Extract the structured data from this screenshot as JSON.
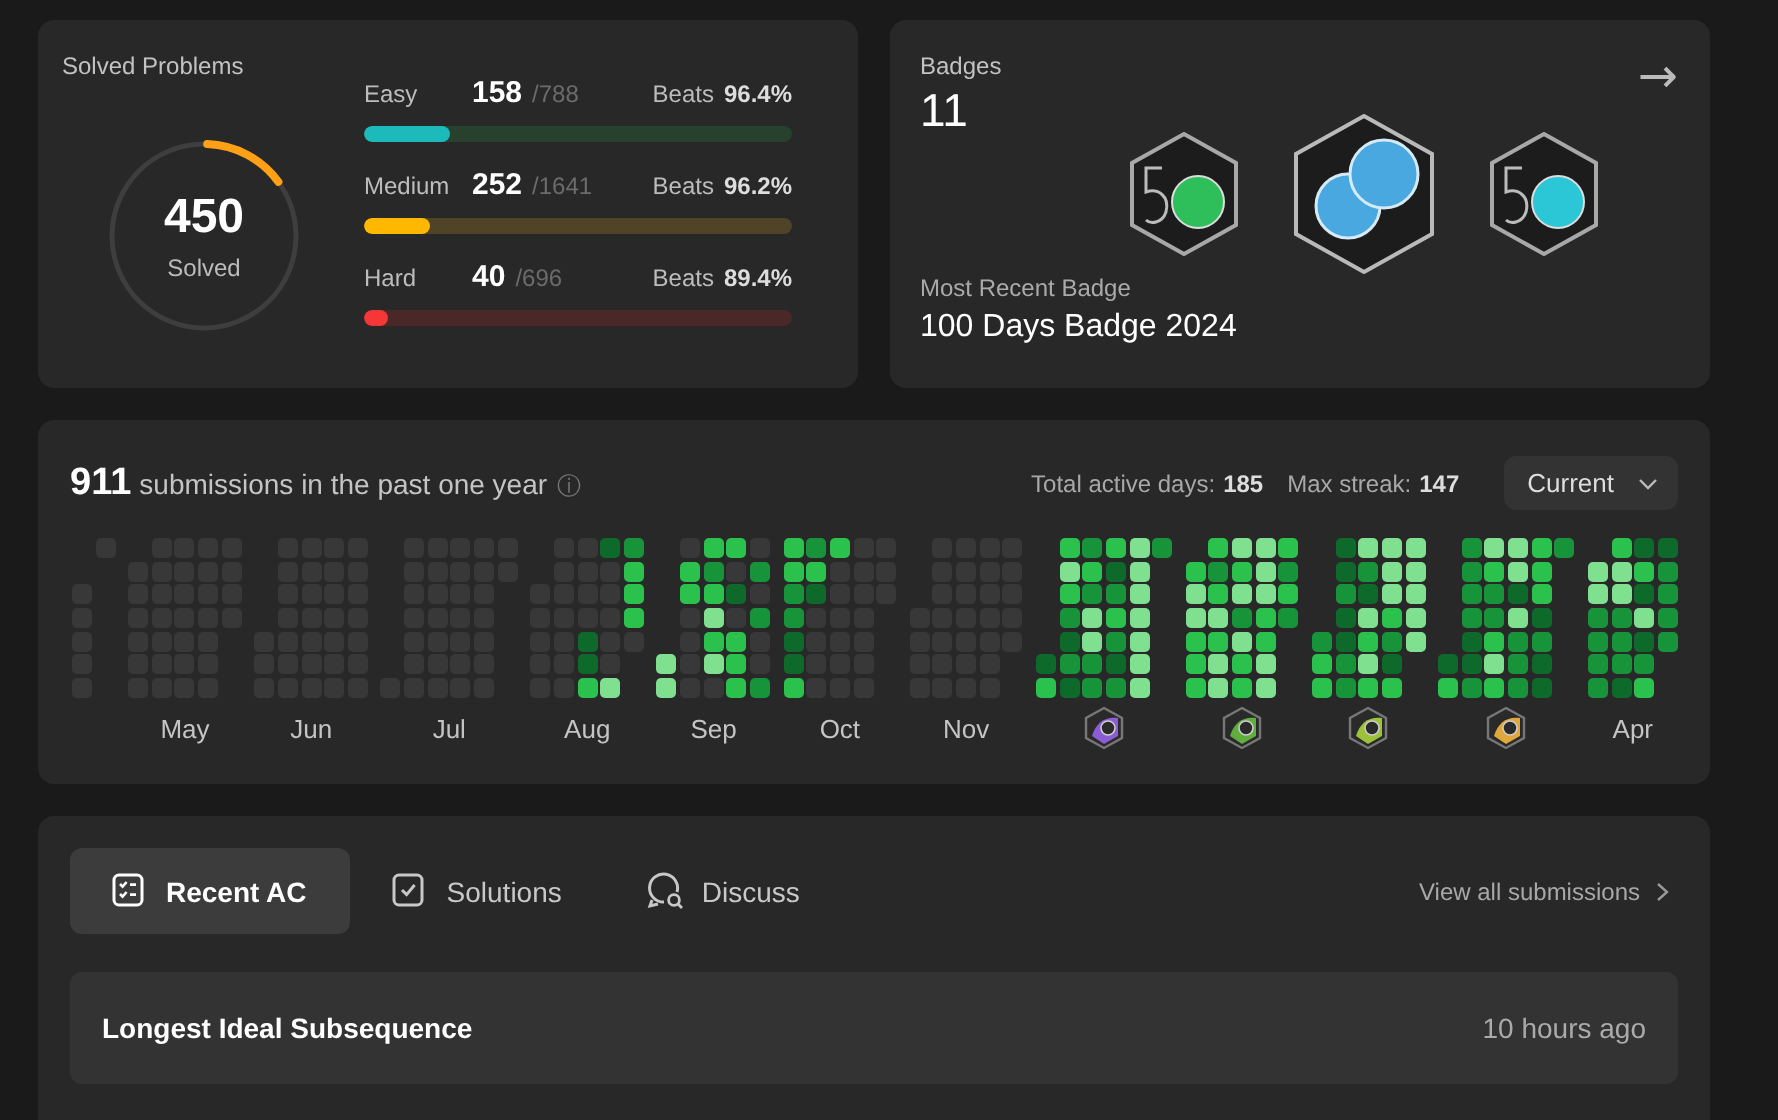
{
  "solved": {
    "title": "Solved Problems",
    "total": "450",
    "caption": "Solved",
    "level": 0.144,
    "difficulties": [
      {
        "kind": "easy",
        "name": "Easy",
        "count": "158",
        "of": "/788",
        "beats_label": "Beats",
        "beats": "96.4%",
        "level": 0.2
      },
      {
        "kind": "medium",
        "name": "Medium",
        "count": "252",
        "of": "/1641",
        "beats_label": "Beats",
        "beats": "96.2%",
        "level": 0.154
      },
      {
        "kind": "hard",
        "name": "Hard",
        "count": "40",
        "of": "/696",
        "beats_label": "Beats",
        "beats": "89.4%",
        "level": 0.057
      }
    ]
  },
  "badges": {
    "title": "Badges",
    "count": "11",
    "arrow": "→",
    "items": [
      {
        "kind": "fifty",
        "color": "#2fbf5a"
      },
      {
        "kind": "hundred",
        "color": "#4aa8e0"
      },
      {
        "kind": "fifty",
        "color": "#2cc7d6"
      }
    ],
    "recent_label": "Most Recent Badge",
    "recent": "100 Days Badge 2024"
  },
  "heatmap": {
    "count": "911",
    "text": "submissions in the past one year",
    "info": "ⓘ",
    "active_label": "Total active days:",
    "active": "185",
    "streak_label": "Max streak:",
    "streak": "147",
    "select": "Current",
    "months": [
      {
        "kind": "none",
        "weeks": [
          {
            "kind": "head",
            "days": [
              {
                "color": "#383838"
              },
              {
                "color": "#383838"
              },
              {
                "color": "#383838"
              },
              {
                "color": "#383838"
              },
              {
                "color": "#383838"
              }
            ]
          },
          {
            "kind": "tail",
            "days": [
              {
                "color": "#383838"
              }
            ]
          }
        ]
      },
      {
        "kind": "month",
        "label": "May",
        "weeks": [
          {
            "kind": "head",
            "days": [
              {
                "color": "#383838"
              },
              {
                "color": "#383838"
              },
              {
                "color": "#383838"
              },
              {
                "color": "#383838"
              },
              {
                "color": "#383838"
              },
              {
                "color": "#383838"
              }
            ]
          },
          {
            "kind": "full",
            "days": [
              {
                "color": "#383838"
              },
              {
                "color": "#383838"
              },
              {
                "color": "#383838"
              },
              {
                "color": "#383838"
              },
              {
                "color": "#383838"
              },
              {
                "color": "#383838"
              },
              {
                "color": "#383838"
              }
            ]
          },
          {
            "kind": "full",
            "days": [
              {
                "color": "#383838"
              },
              {
                "color": "#383838"
              },
              {
                "color": "#383838"
              },
              {
                "color": "#383838"
              },
              {
                "color": "#383838"
              },
              {
                "color": "#383838"
              },
              {
                "color": "#383838"
              }
            ]
          },
          {
            "kind": "full",
            "days": [
              {
                "color": "#383838"
              },
              {
                "color": "#383838"
              },
              {
                "color": "#383838"
              },
              {
                "color": "#383838"
              },
              {
                "color": "#383838"
              },
              {
                "color": "#383838"
              },
              {
                "color": "#383838"
              }
            ]
          },
          {
            "kind": "tail",
            "days": [
              {
                "color": "#383838"
              },
              {
                "color": "#383838"
              },
              {
                "color": "#383838"
              },
              {
                "color": "#383838"
              }
            ]
          }
        ]
      },
      {
        "kind": "month",
        "label": "Jun",
        "weeks": [
          {
            "kind": "head",
            "days": [
              {
                "color": "#383838"
              },
              {
                "color": "#383838"
              },
              {
                "color": "#383838"
              }
            ]
          },
          {
            "kind": "full",
            "days": [
              {
                "color": "#383838"
              },
              {
                "color": "#383838"
              },
              {
                "color": "#383838"
              },
              {
                "color": "#383838"
              },
              {
                "color": "#383838"
              },
              {
                "color": "#383838"
              },
              {
                "color": "#383838"
              }
            ]
          },
          {
            "kind": "full",
            "days": [
              {
                "color": "#383838"
              },
              {
                "color": "#383838"
              },
              {
                "color": "#383838"
              },
              {
                "color": "#383838"
              },
              {
                "color": "#383838"
              },
              {
                "color": "#383838"
              },
              {
                "color": "#383838"
              }
            ]
          },
          {
            "kind": "full",
            "days": [
              {
                "color": "#383838"
              },
              {
                "color": "#383838"
              },
              {
                "color": "#383838"
              },
              {
                "color": "#383838"
              },
              {
                "color": "#383838"
              },
              {
                "color": "#383838"
              },
              {
                "color": "#383838"
              }
            ]
          },
          {
            "kind": "full",
            "days": [
              {
                "color": "#383838"
              },
              {
                "color": "#383838"
              },
              {
                "color": "#383838"
              },
              {
                "color": "#383838"
              },
              {
                "color": "#383838"
              },
              {
                "color": "#383838"
              },
              {
                "color": "#383838"
              }
            ]
          }
        ]
      },
      {
        "kind": "month",
        "label": "Jul",
        "weeks": [
          {
            "kind": "head",
            "days": [
              {
                "color": "#383838"
              }
            ]
          },
          {
            "kind": "full",
            "days": [
              {
                "color": "#383838"
              },
              {
                "color": "#383838"
              },
              {
                "color": "#383838"
              },
              {
                "color": "#383838"
              },
              {
                "color": "#383838"
              },
              {
                "color": "#383838"
              },
              {
                "color": "#383838"
              }
            ]
          },
          {
            "kind": "full",
            "days": [
              {
                "color": "#383838"
              },
              {
                "color": "#383838"
              },
              {
                "color": "#383838"
              },
              {
                "color": "#383838"
              },
              {
                "color": "#383838"
              },
              {
                "color": "#383838"
              },
              {
                "color": "#383838"
              }
            ]
          },
          {
            "kind": "full",
            "days": [
              {
                "color": "#383838"
              },
              {
                "color": "#383838"
              },
              {
                "color": "#383838"
              },
              {
                "color": "#383838"
              },
              {
                "color": "#383838"
              },
              {
                "color": "#383838"
              },
              {
                "color": "#383838"
              }
            ]
          },
          {
            "kind": "full",
            "days": [
              {
                "color": "#383838"
              },
              {
                "color": "#383838"
              },
              {
                "color": "#383838"
              },
              {
                "color": "#383838"
              },
              {
                "color": "#383838"
              },
              {
                "color": "#383838"
              },
              {
                "color": "#383838"
              }
            ]
          },
          {
            "kind": "tail",
            "days": [
              {
                "color": "#383838"
              },
              {
                "color": "#383838"
              }
            ]
          }
        ]
      },
      {
        "kind": "month",
        "label": "Aug",
        "weeks": [
          {
            "kind": "head",
            "days": [
              {
                "color": "#383838"
              },
              {
                "color": "#383838"
              },
              {
                "color": "#383838"
              },
              {
                "color": "#383838"
              },
              {
                "color": "#383838"
              }
            ]
          },
          {
            "kind": "full",
            "days": [
              {
                "color": "#383838"
              },
              {
                "color": "#383838"
              },
              {
                "color": "#383838"
              },
              {
                "color": "#383838"
              },
              {
                "color": "#383838"
              },
              {
                "color": "#383838"
              },
              {
                "color": "#383838"
              }
            ]
          },
          {
            "kind": "full",
            "days": [
              {
                "color": "#383838"
              },
              {
                "color": "#383838"
              },
              {
                "color": "#383838"
              },
              {
                "color": "#383838"
              },
              {
                "color": "#0e6a2a"
              },
              {
                "color": "#0e6a2a"
              },
              {
                "color": "#2ac24d"
              }
            ]
          },
          {
            "kind": "full",
            "days": [
              {
                "color": "#0e6a2a"
              },
              {
                "color": "#383838"
              },
              {
                "color": "#383838"
              },
              {
                "color": "#383838"
              },
              {
                "color": "#383838"
              },
              {
                "color": "#383838"
              },
              {
                "color": "#7fe08f"
              }
            ]
          },
          {
            "kind": "tail",
            "days": [
              {
                "color": "#17933a"
              },
              {
                "color": "#2ac24d"
              },
              {
                "color": "#2ac24d"
              },
              {
                "color": "#2ac24d"
              },
              {
                "color": "#383838"
              }
            ]
          }
        ]
      },
      {
        "kind": "month",
        "label": "Sep",
        "weeks": [
          {
            "kind": "head",
            "days": [
              {
                "color": "#7fe08f"
              },
              {
                "color": "#7fe08f"
              }
            ]
          },
          {
            "kind": "full",
            "days": [
              {
                "color": "#383838"
              },
              {
                "color": "#2ac24d"
              },
              {
                "color": "#2ac24d"
              },
              {
                "color": "#383838"
              },
              {
                "color": "#383838"
              },
              {
                "color": "#383838"
              },
              {
                "color": "#383838"
              }
            ]
          },
          {
            "kind": "full",
            "days": [
              {
                "color": "#2ac24d"
              },
              {
                "color": "#17933a"
              },
              {
                "color": "#2ac24d"
              },
              {
                "color": "#7fe08f"
              },
              {
                "color": "#2ac24d"
              },
              {
                "color": "#7fe08f"
              },
              {
                "color": "#383838"
              }
            ]
          },
          {
            "kind": "full",
            "days": [
              {
                "color": "#2ac24d"
              },
              {
                "color": "#383838"
              },
              {
                "color": "#0e6a2a"
              },
              {
                "color": "#383838"
              },
              {
                "color": "#2ac24d"
              },
              {
                "color": "#2ac24d"
              },
              {
                "color": "#2ac24d"
              }
            ]
          },
          {
            "kind": "full",
            "days": [
              {
                "color": "#383838"
              },
              {
                "color": "#17933a"
              },
              {
                "color": "#383838"
              },
              {
                "color": "#17933a"
              },
              {
                "color": "#383838"
              },
              {
                "color": "#383838"
              },
              {
                "color": "#17933a"
              }
            ]
          }
        ]
      },
      {
        "kind": "month",
        "label": "Oct",
        "weeks": [
          {
            "kind": "full",
            "days": [
              {
                "color": "#2ac24d"
              },
              {
                "color": "#2ac24d"
              },
              {
                "color": "#17933a"
              },
              {
                "color": "#17933a"
              },
              {
                "color": "#0e6a2a"
              },
              {
                "color": "#0e6a2a"
              },
              {
                "color": "#2ac24d"
              }
            ]
          },
          {
            "kind": "full",
            "days": [
              {
                "color": "#17933a"
              },
              {
                "color": "#2ac24d"
              },
              {
                "color": "#0e6a2a"
              },
              {
                "color": "#383838"
              },
              {
                "color": "#383838"
              },
              {
                "color": "#383838"
              },
              {
                "color": "#383838"
              }
            ]
          },
          {
            "kind": "full",
            "days": [
              {
                "color": "#2ac24d"
              },
              {
                "color": "#383838"
              },
              {
                "color": "#383838"
              },
              {
                "color": "#383838"
              },
              {
                "color": "#383838"
              },
              {
                "color": "#383838"
              },
              {
                "color": "#383838"
              }
            ]
          },
          {
            "kind": "full",
            "days": [
              {
                "color": "#383838"
              },
              {
                "color": "#383838"
              },
              {
                "color": "#383838"
              },
              {
                "color": "#383838"
              },
              {
                "color": "#383838"
              },
              {
                "color": "#383838"
              },
              {
                "color": "#383838"
              }
            ]
          },
          {
            "kind": "tail",
            "days": [
              {
                "color": "#383838"
              },
              {
                "color": "#383838"
              },
              {
                "color": "#383838"
              }
            ]
          }
        ]
      },
      {
        "kind": "month",
        "label": "Nov",
        "weeks": [
          {
            "kind": "head",
            "days": [
              {
                "color": "#383838"
              },
              {
                "color": "#383838"
              },
              {
                "color": "#383838"
              },
              {
                "color": "#383838"
              }
            ]
          },
          {
            "kind": "full",
            "days": [
              {
                "color": "#383838"
              },
              {
                "color": "#383838"
              },
              {
                "color": "#383838"
              },
              {
                "color": "#383838"
              },
              {
                "color": "#383838"
              },
              {
                "color": "#383838"
              },
              {
                "color": "#383838"
              }
            ]
          },
          {
            "kind": "full",
            "days": [
              {
                "color": "#383838"
              },
              {
                "color": "#383838"
              },
              {
                "color": "#383838"
              },
              {
                "color": "#383838"
              },
              {
                "color": "#383838"
              },
              {
                "color": "#383838"
              },
              {
                "color": "#383838"
              }
            ]
          },
          {
            "kind": "full",
            "days": [
              {
                "color": "#383838"
              },
              {
                "color": "#383838"
              },
              {
                "color": "#383838"
              },
              {
                "color": "#383838"
              },
              {
                "color": "#383838"
              },
              {
                "color": "#383838"
              },
              {
                "color": "#383838"
              }
            ]
          },
          {
            "kind": "tail",
            "days": [
              {
                "color": "#383838"
              },
              {
                "color": "#383838"
              },
              {
                "color": "#383838"
              },
              {
                "color": "#383838"
              },
              {
                "color": "#383838"
              }
            ]
          }
        ]
      },
      {
        "kind": "badge",
        "color": "#8a5cd6",
        "weeks": [
          {
            "kind": "head",
            "days": [
              {
                "color": "#0e6a2a"
              },
              {
                "color": "#2ac24d"
              }
            ]
          },
          {
            "kind": "full",
            "days": [
              {
                "color": "#2ac24d"
              },
              {
                "color": "#7fe08f"
              },
              {
                "color": "#2ac24d"
              },
              {
                "color": "#17933a"
              },
              {
                "color": "#0e6a2a"
              },
              {
                "color": "#17933a"
              },
              {
                "color": "#0e6a2a"
              }
            ]
          },
          {
            "kind": "full",
            "days": [
              {
                "color": "#17933a"
              },
              {
                "color": "#2ac24d"
              },
              {
                "color": "#17933a"
              },
              {
                "color": "#7fe08f"
              },
              {
                "color": "#7fe08f"
              },
              {
                "color": "#17933a"
              },
              {
                "color": "#17933a"
              }
            ]
          },
          {
            "kind": "full",
            "days": [
              {
                "color": "#2ac24d"
              },
              {
                "color": "#0e6a2a"
              },
              {
                "color": "#17933a"
              },
              {
                "color": "#2ac24d"
              },
              {
                "color": "#17933a"
              },
              {
                "color": "#0e6a2a"
              },
              {
                "color": "#17933a"
              }
            ]
          },
          {
            "kind": "full",
            "days": [
              {
                "color": "#7fe08f"
              },
              {
                "color": "#7fe08f"
              },
              {
                "color": "#7fe08f"
              },
              {
                "color": "#7fe08f"
              },
              {
                "color": "#7fe08f"
              },
              {
                "color": "#7fe08f"
              },
              {
                "color": "#7fe08f"
              }
            ]
          },
          {
            "kind": "tail",
            "days": [
              {
                "color": "#17933a"
              }
            ]
          }
        ]
      },
      {
        "kind": "badge",
        "color": "#5fae3e",
        "weeks": [
          {
            "kind": "head",
            "days": [
              {
                "color": "#2ac24d"
              },
              {
                "color": "#7fe08f"
              },
              {
                "color": "#7fe08f"
              },
              {
                "color": "#2ac24d"
              },
              {
                "color": "#2ac24d"
              },
              {
                "color": "#2ac24d"
              }
            ]
          },
          {
            "kind": "full",
            "days": [
              {
                "color": "#2ac24d"
              },
              {
                "color": "#17933a"
              },
              {
                "color": "#2ac24d"
              },
              {
                "color": "#7fe08f"
              },
              {
                "color": "#2ac24d"
              },
              {
                "color": "#7fe08f"
              },
              {
                "color": "#7fe08f"
              }
            ]
          },
          {
            "kind": "full",
            "days": [
              {
                "color": "#7fe08f"
              },
              {
                "color": "#2ac24d"
              },
              {
                "color": "#7fe08f"
              },
              {
                "color": "#17933a"
              },
              {
                "color": "#7fe08f"
              },
              {
                "color": "#2ac24d"
              },
              {
                "color": "#2ac24d"
              }
            ]
          },
          {
            "kind": "full",
            "days": [
              {
                "color": "#7fe08f"
              },
              {
                "color": "#7fe08f"
              },
              {
                "color": "#7fe08f"
              },
              {
                "color": "#2ac24d"
              },
              {
                "color": "#2ac24d"
              },
              {
                "color": "#7fe08f"
              },
              {
                "color": "#7fe08f"
              }
            ]
          },
          {
            "kind": "tail",
            "days": [
              {
                "color": "#2ac24d"
              },
              {
                "color": "#17933a"
              },
              {
                "color": "#2ac24d"
              },
              {
                "color": "#17933a"
              }
            ]
          }
        ]
      },
      {
        "kind": "badge",
        "color": "#9cc23a",
        "weeks": [
          {
            "kind": "head",
            "days": [
              {
                "color": "#17933a"
              },
              {
                "color": "#2ac24d"
              },
              {
                "color": "#2ac24d"
              }
            ]
          },
          {
            "kind": "full",
            "days": [
              {
                "color": "#0e6a2a"
              },
              {
                "color": "#0e6a2a"
              },
              {
                "color": "#17933a"
              },
              {
                "color": "#0e6a2a"
              },
              {
                "color": "#0e6a2a"
              },
              {
                "color": "#17933a"
              },
              {
                "color": "#17933a"
              }
            ]
          },
          {
            "kind": "full",
            "days": [
              {
                "color": "#7fe08f"
              },
              {
                "color": "#17933a"
              },
              {
                "color": "#0e6a2a"
              },
              {
                "color": "#7fe08f"
              },
              {
                "color": "#2ac24d"
              },
              {
                "color": "#7fe08f"
              },
              {
                "color": "#2ac24d"
              }
            ]
          },
          {
            "kind": "full",
            "days": [
              {
                "color": "#7fe08f"
              },
              {
                "color": "#7fe08f"
              },
              {
                "color": "#7fe08f"
              },
              {
                "color": "#2ac24d"
              },
              {
                "color": "#17933a"
              },
              {
                "color": "#0e6a2a"
              },
              {
                "color": "#2ac24d"
              }
            ]
          },
          {
            "kind": "tail",
            "days": [
              {
                "color": "#7fe08f"
              },
              {
                "color": "#7fe08f"
              },
              {
                "color": "#7fe08f"
              },
              {
                "color": "#7fe08f"
              },
              {
                "color": "#7fe08f"
              }
            ]
          }
        ]
      },
      {
        "kind": "badge",
        "color": "#e0a83a",
        "weeks": [
          {
            "kind": "head",
            "days": [
              {
                "color": "#0e6a2a"
              },
              {
                "color": "#2ac24d"
              }
            ]
          },
          {
            "kind": "full",
            "days": [
              {
                "color": "#17933a"
              },
              {
                "color": "#17933a"
              },
              {
                "color": "#17933a"
              },
              {
                "color": "#17933a"
              },
              {
                "color": "#0e6a2a"
              },
              {
                "color": "#0e6a2a"
              },
              {
                "color": "#17933a"
              }
            ]
          },
          {
            "kind": "full",
            "days": [
              {
                "color": "#7fe08f"
              },
              {
                "color": "#2ac24d"
              },
              {
                "color": "#17933a"
              },
              {
                "color": "#17933a"
              },
              {
                "color": "#2ac24d"
              },
              {
                "color": "#7fe08f"
              },
              {
                "color": "#2ac24d"
              }
            ]
          },
          {
            "kind": "full",
            "days": [
              {
                "color": "#7fe08f"
              },
              {
                "color": "#7fe08f"
              },
              {
                "color": "#0e6a2a"
              },
              {
                "color": "#7fe08f"
              },
              {
                "color": "#17933a"
              },
              {
                "color": "#17933a"
              },
              {
                "color": "#17933a"
              }
            ]
          },
          {
            "kind": "full",
            "days": [
              {
                "color": "#2ac24d"
              },
              {
                "color": "#2ac24d"
              },
              {
                "color": "#2ac24d"
              },
              {
                "color": "#0e6a2a"
              },
              {
                "color": "#17933a"
              },
              {
                "color": "#0e6a2a"
              },
              {
                "color": "#0e6a2a"
              }
            ]
          },
          {
            "kind": "tail",
            "days": [
              {
                "color": "#17933a"
              }
            ]
          }
        ]
      },
      {
        "kind": "month",
        "label": "Apr",
        "weeks": [
          {
            "kind": "head",
            "days": [
              {
                "color": "#7fe08f"
              },
              {
                "color": "#7fe08f"
              },
              {
                "color": "#17933a"
              },
              {
                "color": "#17933a"
              },
              {
                "color": "#17933a"
              },
              {
                "color": "#17933a"
              }
            ]
          },
          {
            "kind": "full",
            "days": [
              {
                "color": "#2ac24d"
              },
              {
                "color": "#7fe08f"
              },
              {
                "color": "#7fe08f"
              },
              {
                "color": "#17933a"
              },
              {
                "color": "#17933a"
              },
              {
                "color": "#17933a"
              },
              {
                "color": "#0e6a2a"
              }
            ]
          },
          {
            "kind": "full",
            "days": [
              {
                "color": "#0e6a2a"
              },
              {
                "color": "#2ac24d"
              },
              {
                "color": "#0e6a2a"
              },
              {
                "color": "#7fe08f"
              },
              {
                "color": "#0e6a2a"
              },
              {
                "color": "#17933a"
              },
              {
                "color": "#2ac24d"
              }
            ]
          },
          {
            "kind": "tail",
            "days": [
              {
                "color": "#0e6a2a"
              },
              {
                "color": "#17933a"
              },
              {
                "color": "#17933a"
              },
              {
                "color": "#17933a"
              },
              {
                "color": "#17933a"
              }
            ]
          }
        ]
      }
    ]
  },
  "activity": {
    "tabs": [
      {
        "kind": "list",
        "label": "Recent AC",
        "selected": true
      },
      {
        "kind": "check",
        "label": "Solutions",
        "selected": false
      },
      {
        "kind": "chat",
        "label": "Discuss",
        "selected": false
      }
    ],
    "view_all": "View all submissions",
    "rows": [
      {
        "title": "Longest Ideal Subsequence",
        "time": "10 hours ago"
      }
    ]
  }
}
